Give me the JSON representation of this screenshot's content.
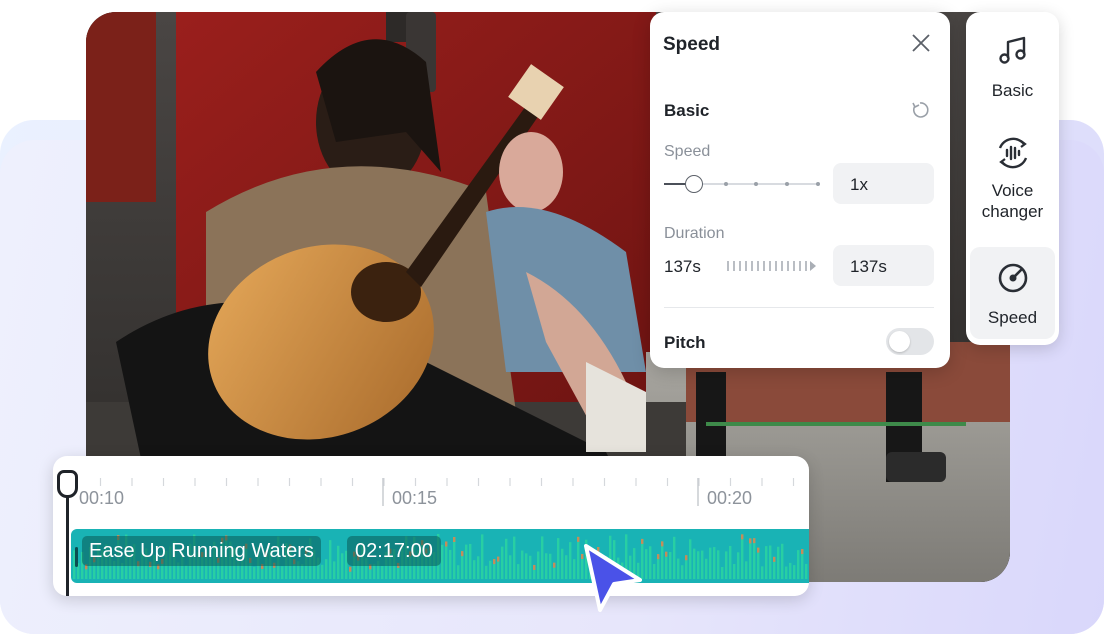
{
  "speed_panel": {
    "title": "Speed",
    "section": "Basic",
    "speed_label": "Speed",
    "speed_value": "1x",
    "duration_label": "Duration",
    "duration_from": "137s",
    "duration_to": "137s",
    "pitch_label": "Pitch",
    "pitch_enabled": false
  },
  "side_menu": {
    "items": [
      {
        "label": "Basic",
        "icon": "music-note-icon"
      },
      {
        "label": "Voice changer",
        "icon": "voice-changer-icon"
      },
      {
        "label": "Speed",
        "icon": "speed-gauge-icon",
        "active": true
      }
    ]
  },
  "timeline": {
    "ticks": [
      "00:10",
      "00:15",
      "00:20"
    ],
    "clip": {
      "title": "Ease Up Running Waters",
      "duration": "02:17:00"
    }
  },
  "colors": {
    "accent": "#4a52e8",
    "track": "#19b3b5",
    "waveform_high": "#c58d5a"
  }
}
